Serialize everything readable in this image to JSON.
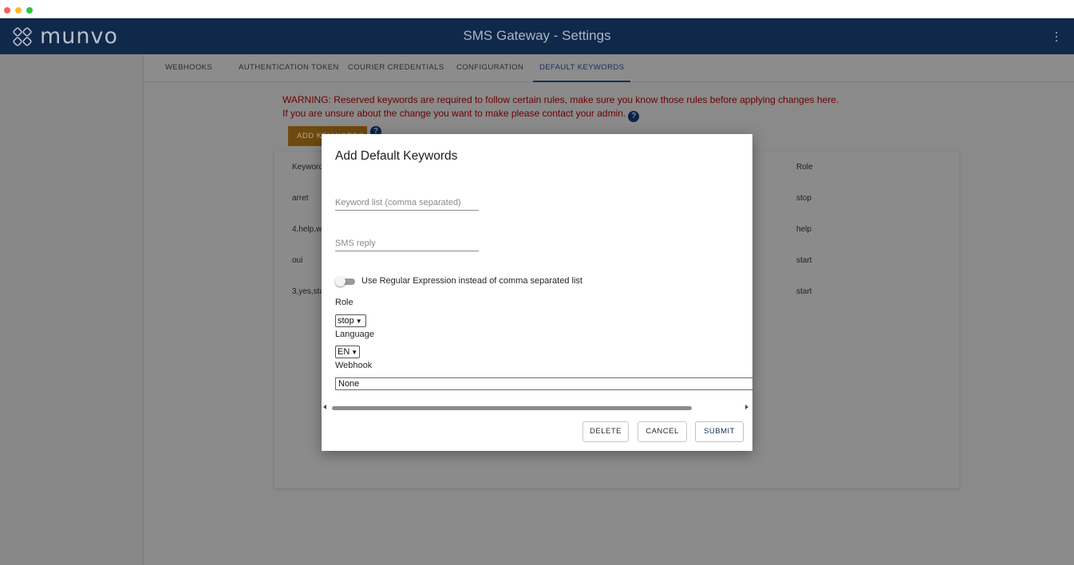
{
  "app": {
    "brand": "munvo",
    "title": "SMS Gateway - Settings"
  },
  "tabs": [
    {
      "label": "WEBHOOKS"
    },
    {
      "label": "AUTHENTICATION TOKEN"
    },
    {
      "label": "COURIER CREDENTIALS"
    },
    {
      "label": "CONFIGURATION"
    },
    {
      "label": "DEFAULT KEYWORDS",
      "active": true
    }
  ],
  "page": {
    "warning_line1": "WARNING: Reserved keywords are required to follow certain rules, make sure you know those rules before applying changes here.",
    "warning_line2": "If you are unsure about the change you want to make please contact your admin.",
    "help_glyph": "?",
    "add_button": "ADD KEYWORDS"
  },
  "table": {
    "headers": {
      "keyword": "Keyword",
      "role": "Role"
    },
    "rows": [
      {
        "keyword": "arret",
        "role": "stop"
      },
      {
        "keyword": "4,help,w",
        "role": "help"
      },
      {
        "keyword": "oui",
        "role": "start"
      },
      {
        "keyword": "3,yes,sta",
        "role": "start"
      }
    ]
  },
  "dialog": {
    "title": "Add Default Keywords",
    "keyword_placeholder": "Keyword list (comma separated)",
    "sms_placeholder": "SMS reply",
    "regex_toggle_label": "Use Regular Expression instead of comma separated list",
    "regex_enabled": false,
    "role_label": "Role",
    "role_value": "stop",
    "language_label": "Language",
    "language_value": "EN",
    "webhook_label": "Webhook",
    "webhook_value": "None",
    "buttons": {
      "delete": "DELETE",
      "cancel": "CANCEL",
      "submit": "SUBMIT"
    }
  },
  "colors": {
    "header_bg": "#10284a",
    "warning_text": "#6e0000",
    "add_button_bg": "#6e4a10",
    "active_tab": "#14305a"
  },
  "icons": [
    "munvo-logo-icon",
    "kebab-menu-icon",
    "help-icon",
    "chevron-down-icon",
    "scroll-left-icon",
    "scroll-right-icon"
  ]
}
